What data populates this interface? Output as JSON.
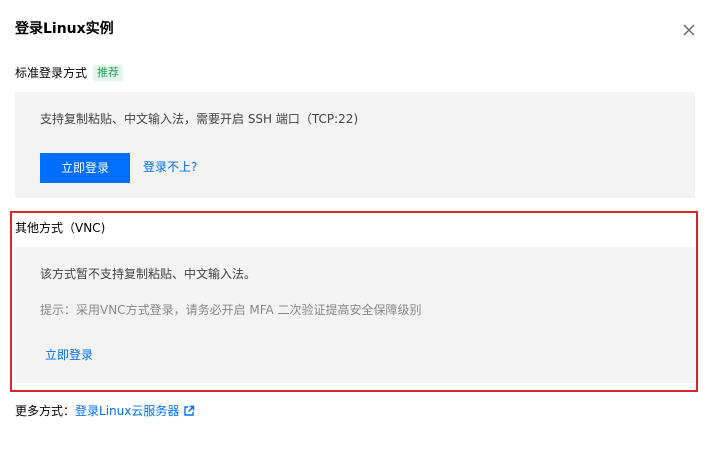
{
  "dialog": {
    "title": "登录Linux实例",
    "close_icon": "close-icon"
  },
  "standard": {
    "heading": "标准登录方式",
    "badge": "推荐",
    "description": "支持复制粘贴、中文输入法，需要开启 SSH 端口（TCP:22)",
    "login_button": "立即登录",
    "cant_login_link": "登录不上?"
  },
  "vnc": {
    "heading": "其他方式（VNC)",
    "description": "该方式暂不支持复制粘贴、中文输入法。",
    "tip": "提示：采用VNC方式登录，请务必开启 MFA 二次验证提高安全保障级别",
    "login_link": "立即登录"
  },
  "more": {
    "label": "更多方式：",
    "link": "登录Linux云服务器",
    "link_icon": "external-link-icon"
  },
  "colors": {
    "primary": "#006eff",
    "badge_green": "#29a35a",
    "highlight_red": "#d9262b",
    "panel_bg": "#f3f3f3"
  }
}
